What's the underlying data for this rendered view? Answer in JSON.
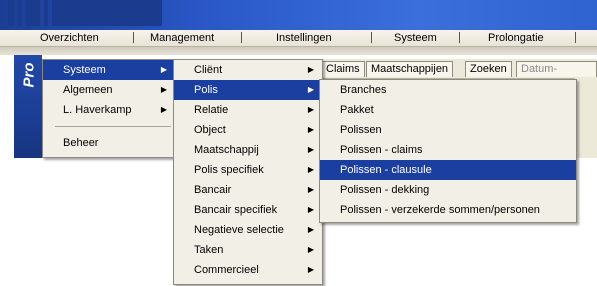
{
  "menubar": {
    "items": [
      "Overzichten",
      "Management",
      "Instellingen",
      "Systeem",
      "Prolongatie"
    ]
  },
  "logo": {
    "text": "Pro"
  },
  "tabs": {
    "items": [
      "Claims",
      "Maatschappijen",
      "Zoeken",
      "Datum-planner"
    ]
  },
  "main_menu": {
    "items": [
      {
        "label": "Systeem",
        "submenu": true,
        "selected": true
      },
      {
        "label": "Algemeen",
        "submenu": true
      },
      {
        "label": "L. Haverkamp",
        "submenu": true
      },
      {
        "label": "Beheer",
        "submenu": false
      }
    ]
  },
  "systeem_menu": {
    "items": [
      {
        "label": "Cliënt",
        "submenu": true
      },
      {
        "label": "Polis",
        "submenu": true,
        "selected": true
      },
      {
        "label": "Relatie",
        "submenu": true
      },
      {
        "label": "Object",
        "submenu": true
      },
      {
        "label": "Maatschappij",
        "submenu": true
      },
      {
        "label": "Polis specifiek",
        "submenu": true
      },
      {
        "label": "Bancair",
        "submenu": true
      },
      {
        "label": "Bancair specifiek",
        "submenu": true
      },
      {
        "label": "Negatieve selectie",
        "submenu": true
      },
      {
        "label": "Taken",
        "submenu": true
      },
      {
        "label": "Commercieel",
        "submenu": true
      }
    ]
  },
  "polis_menu": {
    "items": [
      {
        "label": "Branches"
      },
      {
        "label": "Pakket"
      },
      {
        "label": "Polissen"
      },
      {
        "label": "Polissen - claims"
      },
      {
        "label": "Polissen - clausule",
        "selected": true
      },
      {
        "label": "Polissen - dekking"
      },
      {
        "label": "Polissen - verzekerde sommen/personen"
      }
    ]
  },
  "colors": {
    "selection": "#1a3fa0",
    "menu_bg": "#f2f0e6",
    "titlebar": "#2a58c8"
  },
  "icons": {
    "submenu_arrow": "submenu-arrow-icon"
  }
}
